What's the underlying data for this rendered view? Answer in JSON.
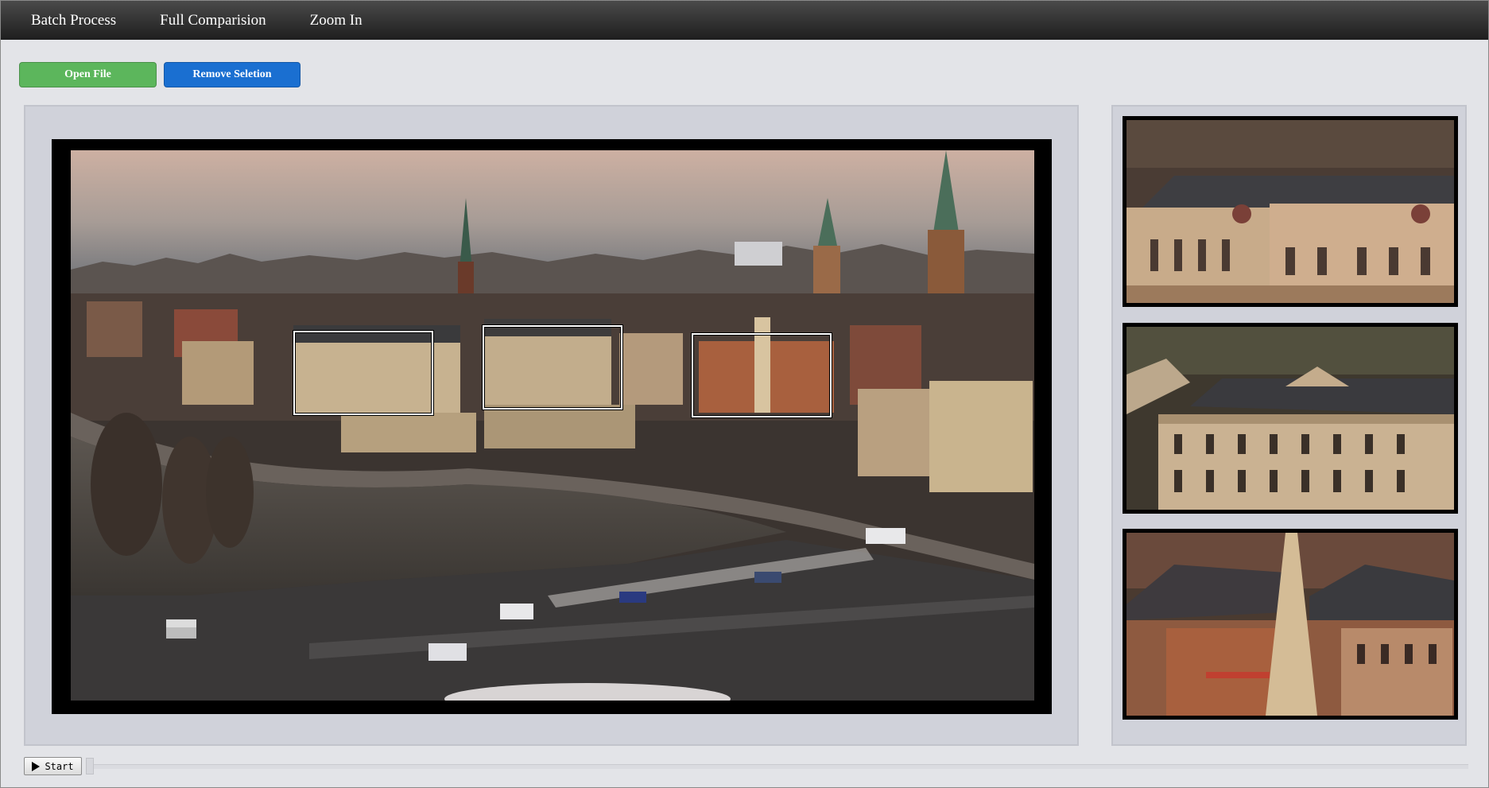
{
  "menu": {
    "items": [
      {
        "label": "Batch Process"
      },
      {
        "label": "Full Comparision"
      },
      {
        "label": "Zoom In"
      }
    ]
  },
  "toolbar": {
    "open_label": "Open File",
    "remove_label": "Remove Seletion",
    "open_color": "#5cb65c",
    "remove_color": "#1a6fd1"
  },
  "viewer": {
    "selection_count": 3
  },
  "playback": {
    "start_label": "Start",
    "progress": 0
  }
}
